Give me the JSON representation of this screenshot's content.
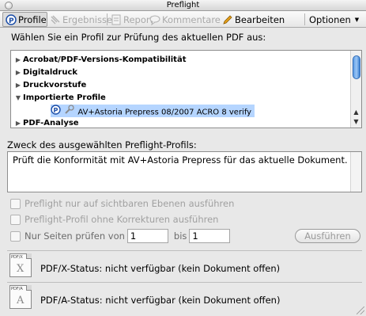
{
  "window": {
    "title": "Preflight"
  },
  "toolbar": {
    "profile": "Profile",
    "results": "Ergebnisse",
    "report": "Report",
    "comments": "Kommentare",
    "edit": "Bearbeiten",
    "options": "Optionen"
  },
  "prompt": "Wählen Sie ein Profil zur Prüfung des aktuellen PDF aus:",
  "tree": {
    "items": [
      {
        "label": "Acrobat/PDF-Versions-Kompatibilität",
        "expanded": false
      },
      {
        "label": "Digitaldruck",
        "expanded": false
      },
      {
        "label": "Druckvorstufe",
        "expanded": false
      },
      {
        "label": "Importierte Profile",
        "expanded": true
      },
      {
        "label": "AV+Astoria Prepress 08/2007 ACRO 8 verify",
        "selected": true
      },
      {
        "label": "PDF-Analyse",
        "expanded": false
      }
    ]
  },
  "purpose": {
    "label": "Zweck des ausgewählten Preflight-Profils:",
    "text": "Prüft die Konformität mit AV+Astoria Prepress für das aktuelle Dokument."
  },
  "options": {
    "visible_layers": "Preflight nur auf sichtbaren Ebenen ausführen",
    "no_fixups": "Preflight-Profil ohne Korrekturen ausführen",
    "pages_from": "Nur Seiten prüfen von",
    "from_value": "1",
    "to_label": "bis",
    "to_value": "1",
    "run_button": "Ausführen"
  },
  "status": {
    "pdfx_icon_tag": "PDF/X",
    "pdfx_icon_letter": "X",
    "pdfx": "PDF/X-Status: nicht verfügbar (kein Dokument offen)",
    "pdfa_icon_tag": "PDF/A",
    "pdfa_icon_letter": "A",
    "pdfa": "PDF/A-Status: nicht verfügbar (kein Dokument offen)"
  },
  "colors": {
    "selection": "#b5d5ff",
    "scroll_thumb": "#5e9de5",
    "edit_pencil": "#e8a21a"
  }
}
